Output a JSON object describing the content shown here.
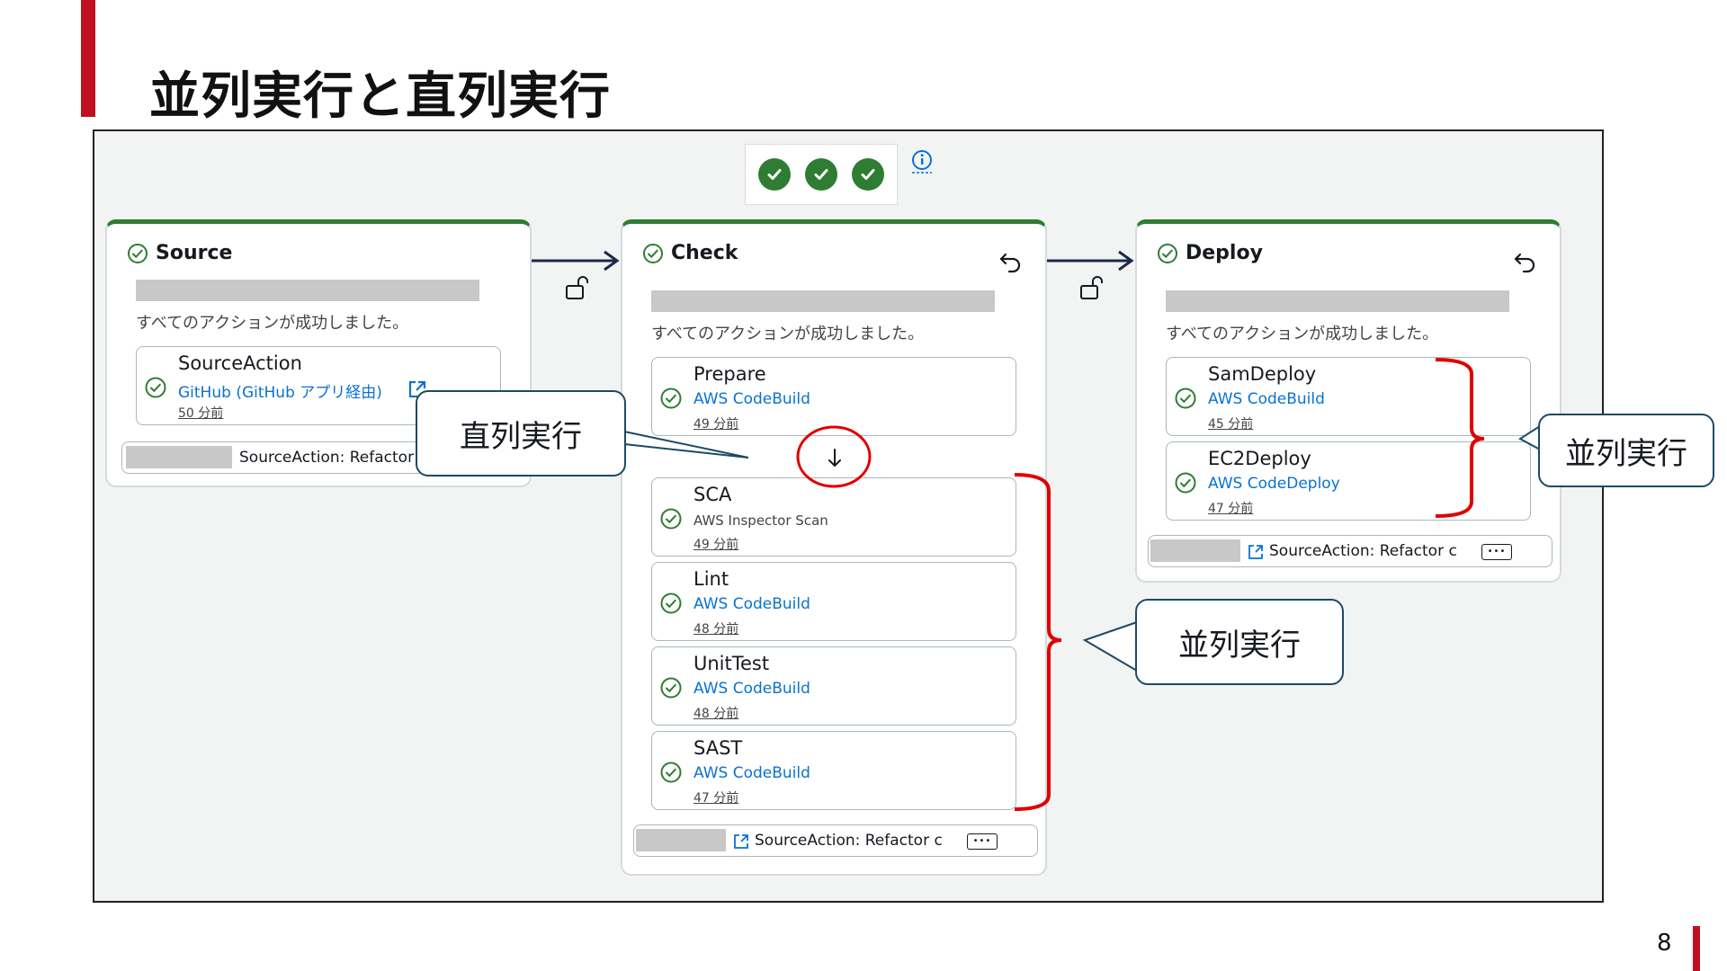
{
  "slide": {
    "title": "並列実行と直列実行",
    "page_number": "8"
  },
  "colors": {
    "accent": "#c0101f",
    "success": "#2e7d32",
    "link": "#0972d3",
    "callout_border": "#1b4a66",
    "annotation": "#e00000"
  },
  "pipeline": {
    "summary_icons": [
      "check-circle-icon",
      "check-circle-icon",
      "check-circle-icon"
    ],
    "stages": [
      {
        "name": "Source",
        "message": "すべてのアクションが成功しました。",
        "actions": [
          {
            "name": "SourceAction",
            "provider": "GitHub (GitHub アプリ経由)",
            "time": "50 分前"
          }
        ],
        "revision": "SourceAction: Refactor"
      },
      {
        "name": "Check",
        "message": "すべてのアクションが成功しました。",
        "actions": [
          {
            "name": "Prepare",
            "provider": "AWS CodeBuild",
            "time": "49 分前"
          },
          {
            "name": "SCA",
            "provider": "AWS Inspector Scan",
            "time": "49 分前"
          },
          {
            "name": "Lint",
            "provider": "AWS CodeBuild",
            "time": "48 分前"
          },
          {
            "name": "UnitTest",
            "provider": "AWS CodeBuild",
            "time": "48 分前"
          },
          {
            "name": "SAST",
            "provider": "AWS CodeBuild",
            "time": "47 分前"
          }
        ],
        "revision": "SourceAction: Refactor c"
      },
      {
        "name": "Deploy",
        "message": "すべてのアクションが成功しました。",
        "actions": [
          {
            "name": "SamDeploy",
            "provider": "AWS CodeBuild",
            "time": "45 分前"
          },
          {
            "name": "EC2Deploy",
            "provider": "AWS CodeDeploy",
            "time": "47 分前"
          }
        ],
        "revision": "SourceAction: Refactor c"
      }
    ],
    "more_button": "•••"
  },
  "callouts": {
    "serial": "直列実行",
    "parallel_check": "並列実行",
    "parallel_deploy": "並列実行"
  }
}
